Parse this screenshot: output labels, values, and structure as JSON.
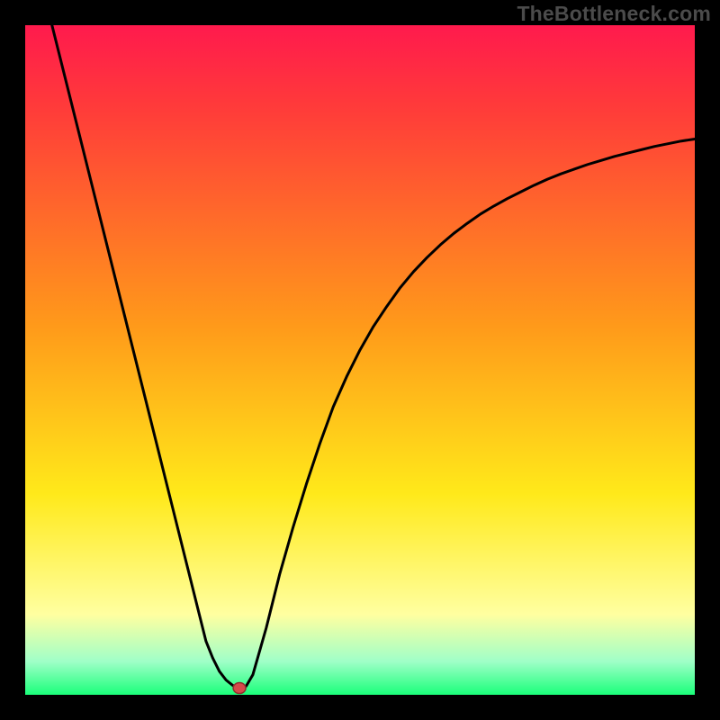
{
  "watermark": "TheBottleneck.com",
  "colors": {
    "black": "#000000",
    "curve": "#000000",
    "marker_fill": "#d64a4a",
    "marker_stroke": "#8f2f2f",
    "gradient_top": "#ff1a4d",
    "gradient_upper_red": "#ff3a3a",
    "gradient_orange": "#ff9a1a",
    "gradient_yellow": "#ffe91a",
    "gradient_pale_yellow": "#ffffa0",
    "gradient_pale_green": "#a0ffc8",
    "gradient_green": "#1aff7a"
  },
  "chart_data": {
    "type": "line",
    "title": "",
    "xlabel": "",
    "ylabel": "",
    "xlim": [
      0,
      100
    ],
    "ylim": [
      0,
      100
    ],
    "series": [
      {
        "name": "bottleneck-curve",
        "x": [
          4.0,
          6.0,
          8.0,
          10.0,
          12.0,
          14.0,
          16.0,
          18.0,
          20.0,
          22.0,
          24.0,
          26.0,
          27.0,
          28.0,
          29.0,
          30.0,
          31.0,
          32.0,
          33.0,
          34.0,
          36.0,
          38.0,
          40.0,
          42.0,
          44.0,
          46.0,
          48.0,
          50.0,
          52.0,
          54.0,
          56.0,
          58.0,
          60.0,
          62.0,
          64.0,
          66.0,
          68.0,
          70.0,
          72.0,
          74.0,
          76.0,
          78.0,
          80.0,
          82.0,
          84.0,
          86.0,
          88.0,
          90.0,
          92.0,
          94.0,
          96.0,
          98.0,
          100.0
        ],
        "y": [
          100.0,
          92.0,
          84.0,
          76.0,
          68.0,
          60.0,
          52.0,
          44.0,
          36.0,
          28.0,
          20.0,
          12.0,
          8.0,
          5.5,
          3.5,
          2.2,
          1.4,
          1.0,
          1.3,
          3.0,
          10.0,
          18.0,
          25.0,
          31.5,
          37.5,
          43.0,
          47.5,
          51.5,
          55.0,
          58.0,
          60.8,
          63.2,
          65.3,
          67.2,
          68.9,
          70.4,
          71.8,
          73.0,
          74.1,
          75.1,
          76.1,
          77.0,
          77.8,
          78.5,
          79.2,
          79.8,
          80.4,
          80.9,
          81.4,
          81.9,
          82.3,
          82.7,
          83.0
        ]
      }
    ],
    "marker": {
      "x": 32.0,
      "y": 1.0
    },
    "gradient_stops": [
      {
        "offset": 0.0,
        "color_key": "gradient_top"
      },
      {
        "offset": 0.12,
        "color_key": "gradient_upper_red"
      },
      {
        "offset": 0.45,
        "color_key": "gradient_orange"
      },
      {
        "offset": 0.7,
        "color_key": "gradient_yellow"
      },
      {
        "offset": 0.88,
        "color_key": "gradient_pale_yellow"
      },
      {
        "offset": 0.95,
        "color_key": "gradient_pale_green"
      },
      {
        "offset": 1.0,
        "color_key": "gradient_green"
      }
    ]
  }
}
